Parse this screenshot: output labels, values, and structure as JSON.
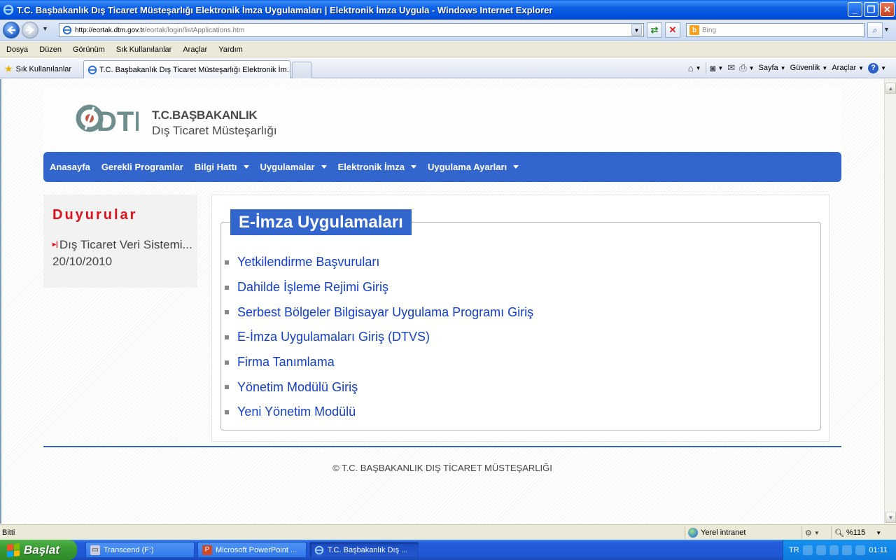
{
  "window": {
    "title": "T.C. Başbakanlık Dış Ticaret Müsteşarlığı Elektronik İmza Uygulamaları | Elektronik İmza Uygula - Windows Internet Explorer"
  },
  "address": {
    "host": "http://eortak.dtm.gov.tr",
    "path": "/eortak/login/listApplications.htm",
    "search_placeholder": "Bing"
  },
  "menu": [
    "Dosya",
    "Düzen",
    "Görünüm",
    "Sık Kullanılanlar",
    "Araçlar",
    "Yardım"
  ],
  "favorites": {
    "label": "Sık Kullanılanlar",
    "tab_title": "T.C. Başbakanlık Dış Ticaret Müsteşarlığı Elektronik İm..."
  },
  "commands": {
    "page": "Sayfa",
    "safety": "Güvenlik",
    "tools": "Araçlar"
  },
  "header": {
    "logo_text": "DTM",
    "org_line1": "T.C.BAŞBAKANLIK",
    "org_line2": "Dış Ticaret Müsteşarlığı"
  },
  "nav": [
    {
      "label": "Anasayfa",
      "dropdown": false
    },
    {
      "label": "Gerekli Programlar",
      "dropdown": false
    },
    {
      "label": "Bilgi Hattı",
      "dropdown": true
    },
    {
      "label": "Uygulamalar",
      "dropdown": true
    },
    {
      "label": "Elektronik İmza",
      "dropdown": true
    },
    {
      "label": "Uygulama Ayarları",
      "dropdown": true
    }
  ],
  "sidebar": {
    "title": "Duyurular",
    "news": "Dış Ticaret Veri Sistemi... 20/10/2010"
  },
  "main": {
    "title": "E-İmza Uygulamaları",
    "apps": [
      "Yetkilendirme Başvuruları",
      "Dahilde İşleme Rejimi Giriş",
      "Serbest Bölgeler Bilgisayar Uygulama Programı Giriş",
      "E-İmza Uygulamaları Giriş (DTVS)",
      "Firma Tanımlama",
      "Yönetim Modülü Giriş",
      "Yeni Yönetim Modülü"
    ]
  },
  "footer": {
    "copyright": "© T.C. BAŞBAKANLIK DIŞ TİCARET MÜSTEŞARLIĞI"
  },
  "status": {
    "text": "Bitti",
    "zone": "Yerel intranet",
    "zoom": "%115"
  },
  "taskbar": {
    "start": "Başlat",
    "tasks": [
      "Transcend (F:)",
      "Microsoft PowerPoint ...",
      "T.C. Başbakanlık Dış ..."
    ],
    "lang": "TR",
    "clock": "01:11"
  }
}
